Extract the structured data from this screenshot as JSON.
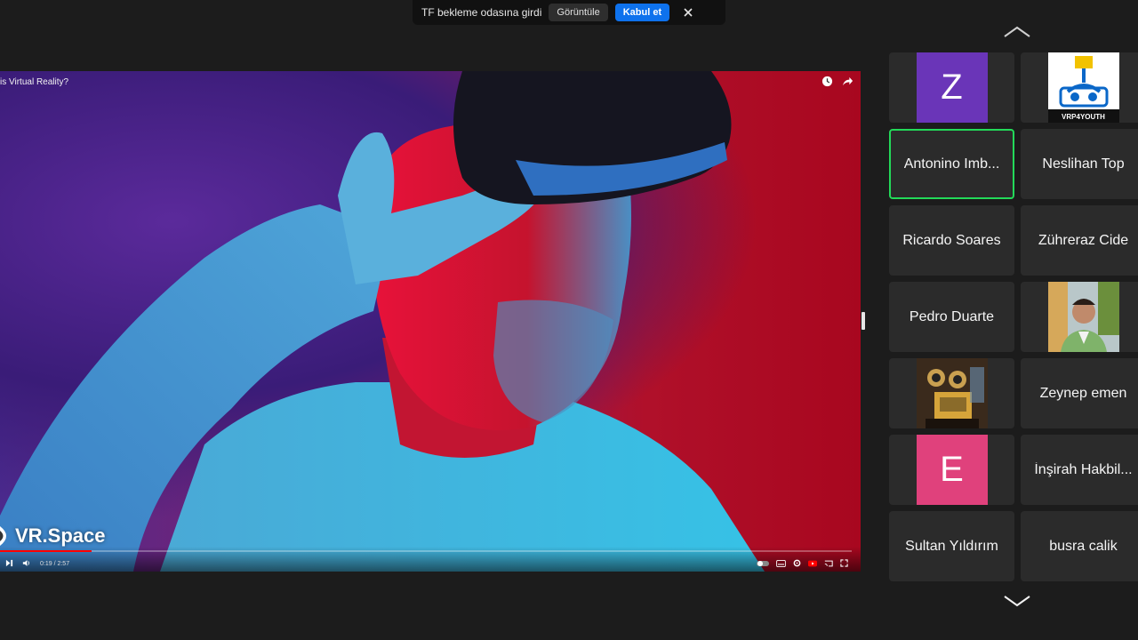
{
  "notification": {
    "message": "TF bekleme odasına girdi",
    "view_label": "Görüntüle",
    "accept_label": "Kabul et",
    "accept_color": "#0e72ed"
  },
  "video": {
    "title": "is Virtual Reality?",
    "watermark": "VR.Space",
    "time": "0:19 / 2:57",
    "progress": 0.107,
    "progress_color": "#ff0000",
    "top_icons": [
      "clock-icon",
      "share-icon"
    ]
  },
  "gallery": {
    "active_border_color": "#23d959",
    "tiles": [
      {
        "kind": "letter",
        "letter": "Z",
        "color": "#6a35b8"
      },
      {
        "kind": "logo",
        "caption": "VRP4YOUTH"
      },
      {
        "kind": "name",
        "name": "Antonino Imb...",
        "active": true
      },
      {
        "kind": "name",
        "name": "Neslihan Top"
      },
      {
        "kind": "name",
        "name": "Ricardo Soares"
      },
      {
        "kind": "name",
        "name": "Zühreraz Cide"
      },
      {
        "kind": "name",
        "name": "Pedro Duarte"
      },
      {
        "kind": "photo"
      },
      {
        "kind": "robot"
      },
      {
        "kind": "name",
        "name": "Zeynep emen"
      },
      {
        "kind": "letter",
        "letter": "E",
        "color": "#e0417c"
      },
      {
        "kind": "name",
        "name": "İnşirah Hakbil..."
      },
      {
        "kind": "name",
        "name": "Sultan Yıldırım"
      },
      {
        "kind": "name",
        "name": "busra calik"
      }
    ]
  }
}
